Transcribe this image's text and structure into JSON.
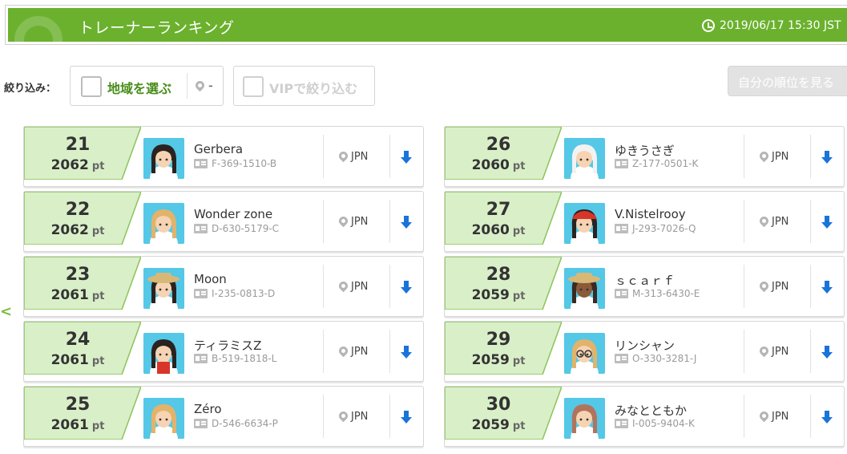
{
  "header": {
    "title": "トレーナーランキング",
    "datetime": "2019/06/17 15:30 JST"
  },
  "filters": {
    "label": "絞り込み：",
    "region_label": "地域を選ぶ",
    "region_value": "-",
    "vip_label": "VIPで絞り込む"
  },
  "my_rank_button": "自分の順位を見る",
  "side_mark": "<",
  "colors": {
    "header_green": "#6bb12e",
    "rank_green": "#d9efc8",
    "rank_border": "#8cc45a",
    "avatar_bg": "#54c8e6",
    "arrow_blue": "#1a73d9"
  },
  "left_column": [
    {
      "rank": "21",
      "points": "2062",
      "unit": "pt",
      "name": "Gerbera",
      "trainer_id": "F-369-1510-B",
      "country": "JPN",
      "avatar": "dark-hair-girl"
    },
    {
      "rank": "22",
      "points": "2062",
      "unit": "pt",
      "name": "Wonder zone",
      "trainer_id": "D-630-5179-C",
      "country": "JPN",
      "avatar": "blonde-girl"
    },
    {
      "rank": "23",
      "points": "2061",
      "unit": "pt",
      "name": "Moon",
      "trainer_id": "I-235-0813-D",
      "country": "JPN",
      "avatar": "dark-hair-girl-hat"
    },
    {
      "rank": "24",
      "points": "2061",
      "unit": "pt",
      "name": "ティラミスZ",
      "trainer_id": "B-519-1818-L",
      "country": "JPN",
      "avatar": "boy-red-shirt"
    },
    {
      "rank": "25",
      "points": "2061",
      "unit": "pt",
      "name": "Zéro",
      "trainer_id": "D-546-6634-P",
      "country": "JPN",
      "avatar": "blonde-girl"
    }
  ],
  "right_column": [
    {
      "rank": "26",
      "points": "2060",
      "unit": "pt",
      "name": "ゆきうさぎ",
      "trainer_id": "Z-177-0501-K",
      "country": "JPN",
      "avatar": "white-hair-girl"
    },
    {
      "rank": "27",
      "points": "2060",
      "unit": "pt",
      "name": "V.Nistelrooy",
      "trainer_id": "J-293-7026-Q",
      "country": "JPN",
      "avatar": "boy-red-cap"
    },
    {
      "rank": "28",
      "points": "2059",
      "unit": "pt",
      "name": "ｓｃａｒｆ",
      "trainer_id": "M-313-6430-E",
      "country": "JPN",
      "avatar": "dark-skin-girl"
    },
    {
      "rank": "29",
      "points": "2059",
      "unit": "pt",
      "name": "リンシャン",
      "trainer_id": "O-330-3281-J",
      "country": "JPN",
      "avatar": "blonde-girl-glasses"
    },
    {
      "rank": "30",
      "points": "2059",
      "unit": "pt",
      "name": "みなとともか",
      "trainer_id": "I-005-9404-K",
      "country": "JPN",
      "avatar": "brown-hair-girl"
    }
  ]
}
